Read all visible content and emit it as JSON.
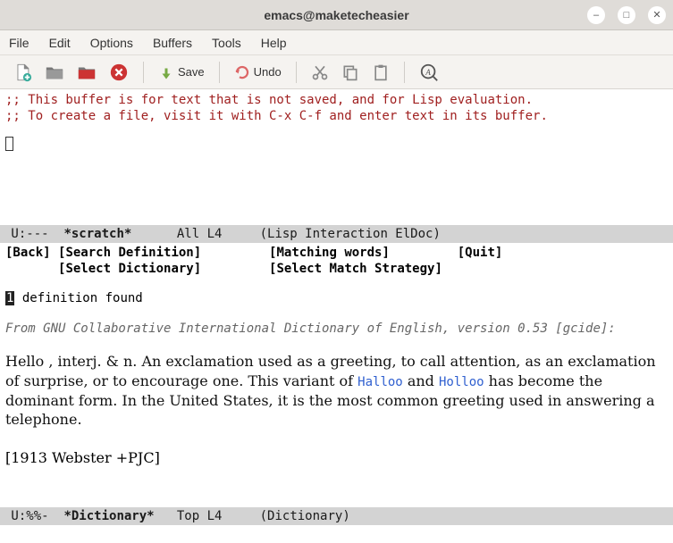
{
  "window": {
    "title": "emacs@maketecheasier"
  },
  "menubar": {
    "items": [
      "File",
      "Edit",
      "Options",
      "Buffers",
      "Tools",
      "Help"
    ]
  },
  "toolbar": {
    "save_label": "Save",
    "undo_label": "Undo"
  },
  "scratch": {
    "comment1": ";; This buffer is for text that is not saved, and for Lisp evaluation.",
    "comment2": ";; To create a file, visit it with C-x C-f and enter text in its buffer."
  },
  "modeline1": {
    "left": " U:---  ",
    "buffer": "*scratch*",
    "mid": "      All L4     ",
    "mode": "(Lisp Interaction ElDoc)"
  },
  "dictbar": {
    "back": "[Back]",
    "search": "[Search Definition]",
    "matching": "[Matching words]",
    "quit": "[Quit]",
    "select_dict": "[Select Dictionary]",
    "select_strategy": "[Select Match Strategy]"
  },
  "dict": {
    "count_prefix": "1",
    "count_suffix": " definition found",
    "source": "From GNU Collaborative International Dictionary of English, version 0.53 [gcide]:",
    "body_part1": " Hello , interj. & n. An exclamation used as a greeting, to call attention, as an exclamation of surprise, or to encourage one.  This variant of ",
    "link1": "Halloo",
    "body_part2": " and ",
    "link2": "Holloo",
    "body_part3": " has become the dominant form.  In the United States, it is the most common greeting used in answering a telephone.",
    "attribution": "[1913 Webster +PJC]"
  },
  "modeline2": {
    "left": " U:%%-  ",
    "buffer": "*Dictionary*",
    "mid": "   Top L4     ",
    "mode": "(Dictionary)"
  }
}
